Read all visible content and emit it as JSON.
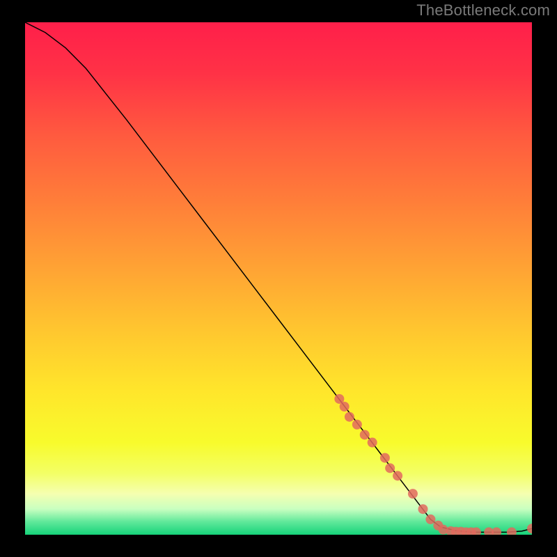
{
  "watermark": "TheBottleneck.com",
  "chart_data": {
    "type": "line",
    "title": "",
    "xlabel": "",
    "ylabel": "",
    "xlim": [
      0,
      100
    ],
    "ylim": [
      0,
      100
    ],
    "grid": false,
    "legend": false,
    "series": [
      {
        "name": "curve",
        "x": [
          0,
          4,
          8,
          12,
          16,
          20,
          25,
          30,
          35,
          40,
          45,
          50,
          55,
          60,
          65,
          70,
          75,
          80,
          82,
          85,
          88,
          90,
          92,
          95,
          98,
          100
        ],
        "y": [
          100,
          98,
          95,
          91,
          86,
          81,
          74.5,
          68,
          61.5,
          55,
          48.5,
          42,
          35.5,
          29,
          22.5,
          16,
          9.5,
          3,
          1.5,
          0.8,
          0.5,
          0.5,
          0.5,
          0.5,
          0.7,
          1.2
        ]
      }
    ],
    "scatter": {
      "name": "markers",
      "points": [
        {
          "x": 62.0,
          "y": 26.5
        },
        {
          "x": 63.0,
          "y": 25.0
        },
        {
          "x": 64.0,
          "y": 23.0
        },
        {
          "x": 65.5,
          "y": 21.5
        },
        {
          "x": 67.0,
          "y": 19.5
        },
        {
          "x": 68.5,
          "y": 18.0
        },
        {
          "x": 71.0,
          "y": 15.0
        },
        {
          "x": 72.0,
          "y": 13.0
        },
        {
          "x": 73.5,
          "y": 11.5
        },
        {
          "x": 76.5,
          "y": 8.0
        },
        {
          "x": 78.5,
          "y": 5.0
        },
        {
          "x": 80.0,
          "y": 3.0
        },
        {
          "x": 81.5,
          "y": 1.8
        },
        {
          "x": 82.5,
          "y": 1.0
        },
        {
          "x": 84.0,
          "y": 0.7
        },
        {
          "x": 85.0,
          "y": 0.6
        },
        {
          "x": 86.0,
          "y": 0.6
        },
        {
          "x": 87.0,
          "y": 0.5
        },
        {
          "x": 88.0,
          "y": 0.5
        },
        {
          "x": 89.0,
          "y": 0.5
        },
        {
          "x": 91.5,
          "y": 0.5
        },
        {
          "x": 93.0,
          "y": 0.5
        },
        {
          "x": 96.0,
          "y": 0.5
        },
        {
          "x": 100.0,
          "y": 1.2
        }
      ]
    },
    "background_gradient": {
      "stops": [
        {
          "offset": 0.0,
          "color": "#ff1f4a"
        },
        {
          "offset": 0.1,
          "color": "#ff3246"
        },
        {
          "offset": 0.22,
          "color": "#ff5a3f"
        },
        {
          "offset": 0.35,
          "color": "#ff7e39"
        },
        {
          "offset": 0.48,
          "color": "#ffa334"
        },
        {
          "offset": 0.6,
          "color": "#ffc62f"
        },
        {
          "offset": 0.72,
          "color": "#ffe62b"
        },
        {
          "offset": 0.82,
          "color": "#f8fb2c"
        },
        {
          "offset": 0.88,
          "color": "#f3ff65"
        },
        {
          "offset": 0.92,
          "color": "#f5ffb0"
        },
        {
          "offset": 0.95,
          "color": "#c8ffc0"
        },
        {
          "offset": 0.975,
          "color": "#5fe89a"
        },
        {
          "offset": 1.0,
          "color": "#16d37a"
        }
      ]
    }
  }
}
